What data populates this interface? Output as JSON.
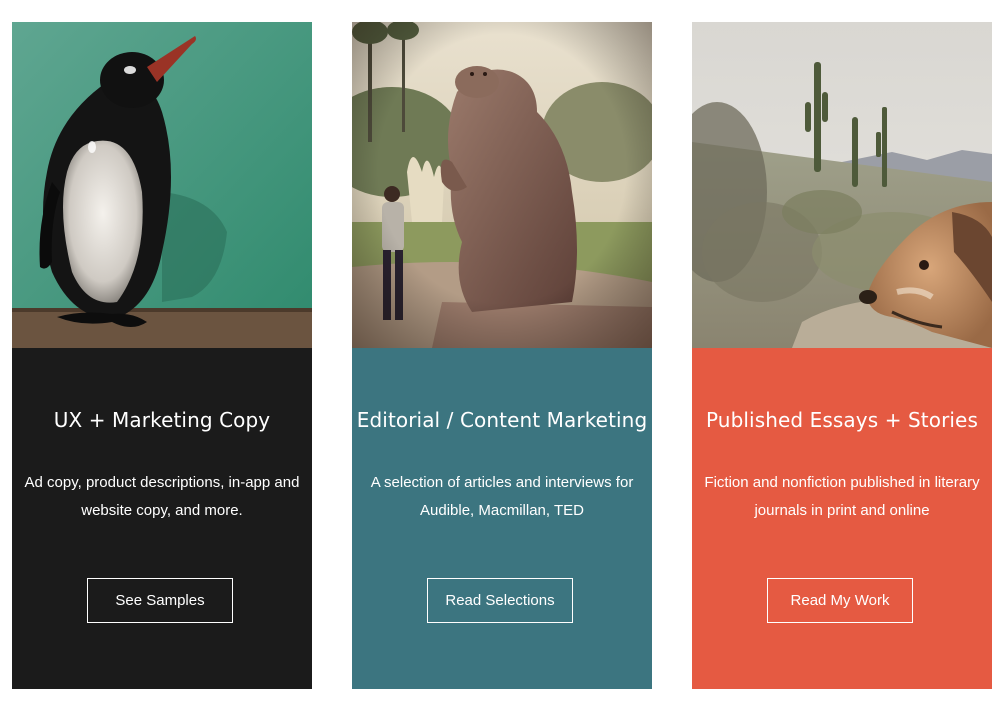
{
  "cards": [
    {
      "title": "UX + Marketing Copy",
      "description": "Ad copy, product descriptions, in-app and website copy, and more.",
      "button_label": "See Samples",
      "panel_color": "#1b1b1b",
      "photo": "penguin-figurine-photo"
    },
    {
      "title": "Editorial / Content Marketing",
      "description": "A selection of articles and interviews for Audible, Macmillan, TED",
      "button_label": "Read Selections",
      "panel_color": "#3c7580",
      "photo": "giant-sloth-statue-photo"
    },
    {
      "title": "Published Essays + Stories",
      "description": "Fiction and nonfiction published in literary journals in print and online",
      "button_label": "Read My Work",
      "panel_color": "#e55a42",
      "photo": "dog-in-desert-photo"
    }
  ]
}
